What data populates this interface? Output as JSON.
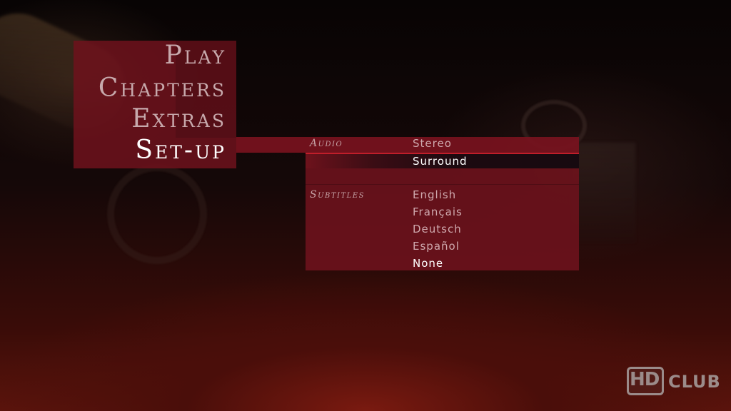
{
  "main_menu": {
    "items": [
      {
        "label": "Play"
      },
      {
        "label": "Chapters"
      },
      {
        "label": "Extras"
      },
      {
        "label": "Set-up"
      }
    ],
    "selected_index": 3
  },
  "setup": {
    "audio": {
      "label": "Audio",
      "options": [
        "Stereo",
        "Surround"
      ],
      "selected": "Surround"
    },
    "subtitles": {
      "label": "Subtitles",
      "options": [
        "English",
        "Français",
        "Deutsch",
        "Español",
        "None"
      ],
      "selected": "None"
    }
  },
  "watermark": {
    "hd": "HD",
    "club": "CLUB"
  },
  "colors": {
    "panel": "#6e121c",
    "highlight_line": "#c01e2a",
    "active_text": "#ffffff",
    "inactive_text": "#cfa9ae"
  }
}
